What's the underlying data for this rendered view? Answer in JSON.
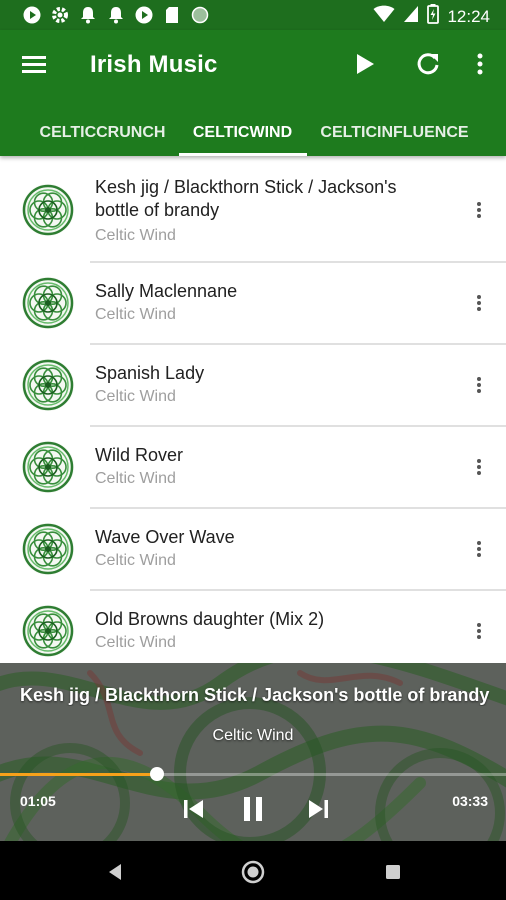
{
  "status_bar": {
    "time": "12:24",
    "left_icons": [
      "play-circle-icon",
      "gear-icon",
      "bell-icon",
      "bell-icon",
      "play-circle-icon",
      "sd-card-icon",
      "dot-icon"
    ],
    "right_icons": [
      "wifi-icon",
      "signal-icon",
      "battery-icon"
    ]
  },
  "app_bar": {
    "title": "Irish Music",
    "actions": [
      "play-icon",
      "refresh-icon",
      "more-vert-icon"
    ]
  },
  "tabs": [
    {
      "label": "CELTICCRUNCH",
      "selected": false
    },
    {
      "label": "CELTICWIND",
      "selected": true
    },
    {
      "label": "CELTICINFLUENCE",
      "selected": false
    }
  ],
  "tracks": [
    {
      "title": "Kesh jig / Blackthorn Stick / Jackson's bottle of brandy",
      "artist": "Celtic Wind"
    },
    {
      "title": "Sally Maclennane",
      "artist": "Celtic Wind"
    },
    {
      "title": "Spanish Lady",
      "artist": "Celtic Wind"
    },
    {
      "title": "Wild Rover",
      "artist": "Celtic Wind"
    },
    {
      "title": "Wave Over Wave",
      "artist": "Celtic Wind"
    },
    {
      "title": "Old Browns daughter (Mix 2)",
      "artist": "Celtic Wind"
    }
  ],
  "now_playing": {
    "title": "Kesh jig / Blackthorn Stick / Jackson's bottle of brandy",
    "artist": "Celtic Wind",
    "elapsed": "01:05",
    "total": "03:33",
    "progress": 0.31,
    "accent_color": "#f7a11a"
  },
  "colors": {
    "primary": "#1e7b1e",
    "status_bar": "#1e6e1e"
  }
}
